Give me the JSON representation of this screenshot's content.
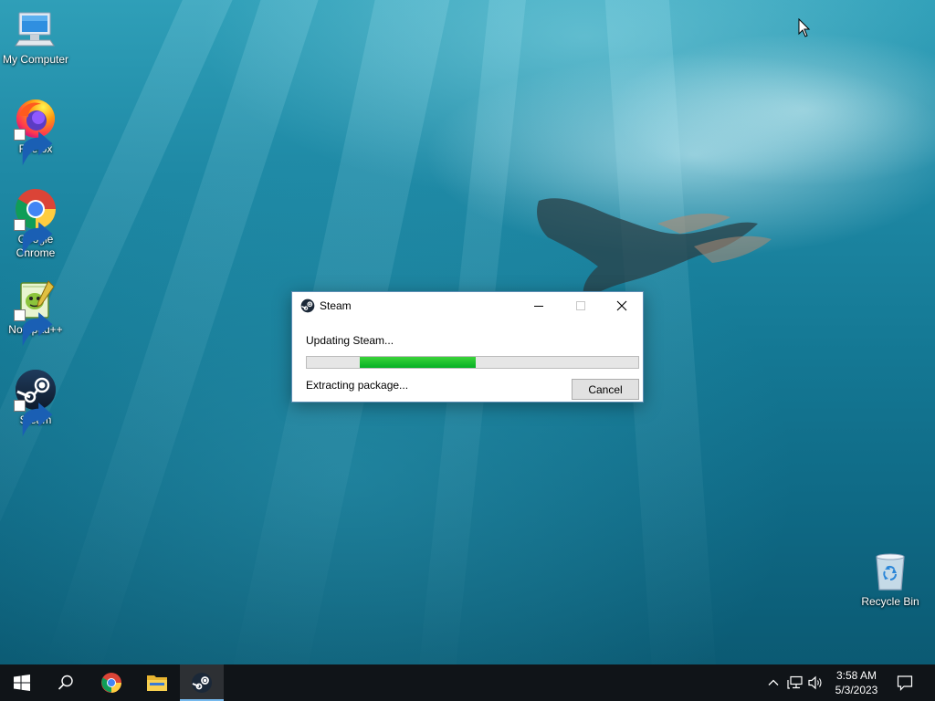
{
  "desktop": {
    "icons": [
      {
        "label": "My Computer",
        "icon": "computer-icon",
        "shortcut": false
      },
      {
        "label": "Firefox",
        "icon": "firefox-icon",
        "shortcut": true
      },
      {
        "label": "Google Chrome",
        "icon": "chrome-icon",
        "shortcut": true
      },
      {
        "label": "Notepad++",
        "icon": "notepad-plus-plus-icon",
        "shortcut": true
      },
      {
        "label": "Steam",
        "icon": "steam-icon",
        "shortcut": true
      },
      {
        "label": "Recycle Bin",
        "icon": "recycle-bin-icon",
        "shortcut": false
      }
    ]
  },
  "dialog": {
    "title": "Steam",
    "title_icon": "steam-icon",
    "status": "Updating Steam...",
    "detail": "Extracting package...",
    "cancel_label": "Cancel",
    "progress": {
      "start": 0.16,
      "end": 0.51,
      "color": "#06b025"
    }
  },
  "taskbar": {
    "buttons": [
      {
        "name": "start",
        "icon": "windows-logo-icon"
      },
      {
        "name": "search",
        "icon": "search-icon"
      },
      {
        "name": "chrome",
        "icon": "chrome-icon"
      },
      {
        "name": "file-explorer",
        "icon": "folder-icon"
      },
      {
        "name": "steam",
        "icon": "steam-icon",
        "active": true
      }
    ],
    "tray": {
      "icons": [
        "chevron-up-icon",
        "network-icon",
        "volume-icon"
      ],
      "time": "3:58 AM",
      "date": "5/3/2023",
      "notification_icon": "notification-icon"
    },
    "accent_color": "#76b9ed"
  }
}
